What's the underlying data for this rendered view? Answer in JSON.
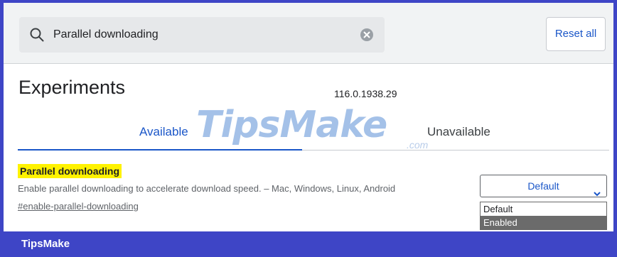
{
  "search": {
    "value": "Parallel downloading"
  },
  "header": {
    "reset_label": "Reset all"
  },
  "page": {
    "title": "Experiments",
    "version": "116.0.1938.29"
  },
  "tabs": [
    {
      "label": "Available",
      "active": true
    },
    {
      "label": "Unavailable",
      "active": false
    }
  ],
  "experiment": {
    "title": "Parallel downloading",
    "description": "Enable parallel downloading to accelerate download speed. – Mac, Windows, Linux, Android",
    "link": "#enable-parallel-downloading",
    "select_value": "Default",
    "options": [
      "Default",
      "Enabled"
    ],
    "highlighted_option": "Enabled"
  },
  "watermark": {
    "brand": "TipsMake",
    "suffix": ".com"
  },
  "footer": {
    "label": "TipsMake"
  },
  "colors": {
    "accent": "#1a56c8",
    "frame": "#3e45c6",
    "highlight": "#fff200"
  },
  "icons": {
    "search": "search-icon",
    "clear": "clear-icon",
    "chevron": "chevron-down-icon"
  }
}
